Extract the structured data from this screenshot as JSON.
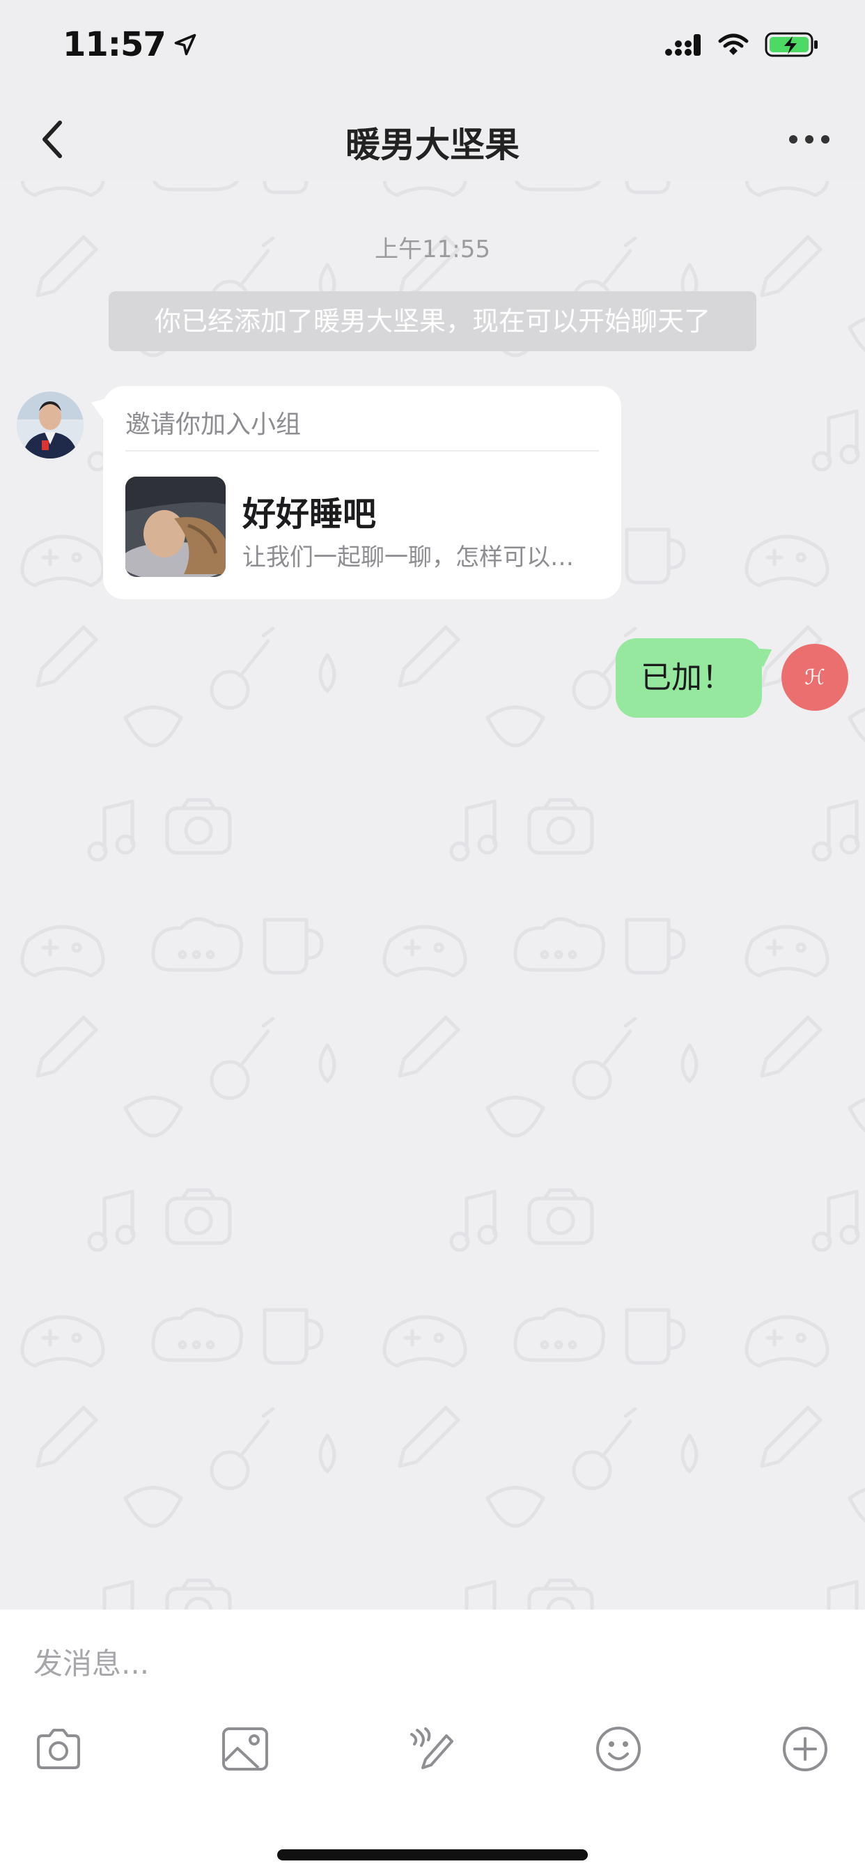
{
  "status_bar": {
    "time": "11:57"
  },
  "header": {
    "title": "暖男大坚果",
    "back_icon": "chevron-left-icon",
    "more_icon": "ellipsis-icon"
  },
  "chat": {
    "timestamp": "上午11:55",
    "system_notice": "你已经添加了暖男大坚果，现在可以开始聊天了",
    "invite_card": {
      "header": "邀请你加入小组",
      "group_name": "好好睡吧",
      "group_desc": "让我们一起聊一聊，怎样可以…"
    },
    "outgoing_message": "已加！",
    "avatar_right_text": "ℋ"
  },
  "composer": {
    "placeholder": "发消息...",
    "tools": [
      "camera-icon",
      "image-icon",
      "voice-pen-icon",
      "emoji-icon",
      "plus-circle-icon"
    ]
  },
  "colors": {
    "background": "#efeff1",
    "outgoing_bubble": "#95e89e",
    "avatar_right": "#ec6f6f",
    "notice_bg": "#d7d7da"
  }
}
